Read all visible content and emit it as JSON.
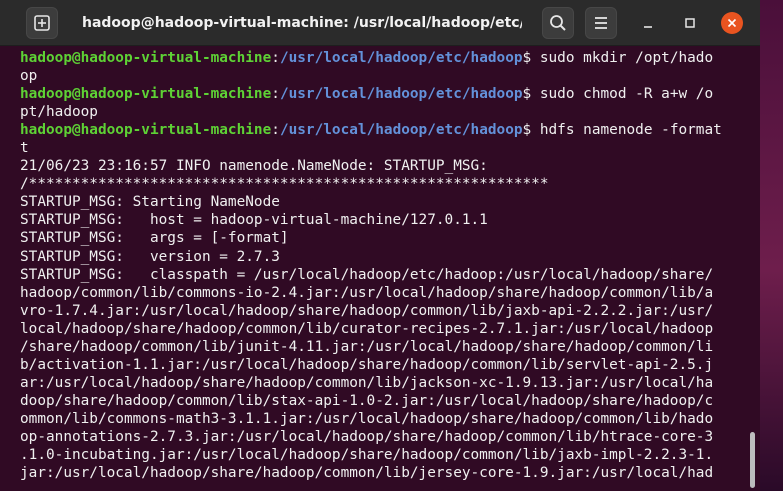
{
  "window": {
    "title": "hadoop@hadoop-virtual-machine: /usr/local/hadoop/etc/ha...",
    "icons": {
      "new_tab": "new-tab-icon",
      "search": "search-icon",
      "menu": "hamburger-menu-icon",
      "minimize": "minimize-icon",
      "maximize": "maximize-icon",
      "close": "close-icon"
    },
    "colors": {
      "terminal_bg": "#300a24",
      "prompt_user": "#5ed235",
      "prompt_path": "#6391d9",
      "text": "#f0f0f0",
      "close_button": "#e95420"
    }
  },
  "terminal": {
    "lines": [
      {
        "user": "hadoop@hadoop-virtual-machine",
        "sep": ":",
        "path": "/usr/local/hadoop/etc/hadoop",
        "text": "$ sudo mkdir /opt/hado"
      },
      {
        "text": "op"
      },
      {
        "user": "hadoop@hadoop-virtual-machine",
        "sep": ":",
        "path": "/usr/local/hadoop/etc/hadoop",
        "text": "$ sudo chmod -R a+w /o"
      },
      {
        "text": "pt/hadoop"
      },
      {
        "user": "hadoop@hadoop-virtual-machine",
        "sep": ":",
        "path": "/usr/local/hadoop/etc/hadoop",
        "text": "$ hdfs namenode -format"
      },
      {
        "text": "t"
      },
      {
        "text": "21/06/23 23:16:57 INFO namenode.NameNode: STARTUP_MSG:"
      },
      {
        "text": "/************************************************************"
      },
      {
        "text": "STARTUP_MSG: Starting NameNode"
      },
      {
        "text": "STARTUP_MSG:   host = hadoop-virtual-machine/127.0.1.1"
      },
      {
        "text": "STARTUP_MSG:   args = [-format]"
      },
      {
        "text": "STARTUP_MSG:   version = 2.7.3"
      },
      {
        "text": "STARTUP_MSG:   classpath = /usr/local/hadoop/etc/hadoop:/usr/local/hadoop/share/"
      },
      {
        "text": "hadoop/common/lib/commons-io-2.4.jar:/usr/local/hadoop/share/hadoop/common/lib/a"
      },
      {
        "text": "vro-1.7.4.jar:/usr/local/hadoop/share/hadoop/common/lib/jaxb-api-2.2.2.jar:/usr/"
      },
      {
        "text": "local/hadoop/share/hadoop/common/lib/curator-recipes-2.7.1.jar:/usr/local/hadoop"
      },
      {
        "text": "/share/hadoop/common/lib/junit-4.11.jar:/usr/local/hadoop/share/hadoop/common/li"
      },
      {
        "text": "b/activation-1.1.jar:/usr/local/hadoop/share/hadoop/common/lib/servlet-api-2.5.j"
      },
      {
        "text": "ar:/usr/local/hadoop/share/hadoop/common/lib/jackson-xc-1.9.13.jar:/usr/local/ha"
      },
      {
        "text": "doop/share/hadoop/common/lib/stax-api-1.0-2.jar:/usr/local/hadoop/share/hadoop/c"
      },
      {
        "text": "ommon/lib/commons-math3-3.1.1.jar:/usr/local/hadoop/share/hadoop/common/lib/hado"
      },
      {
        "text": "op-annotations-2.7.3.jar:/usr/local/hadoop/share/hadoop/common/lib/htrace-core-3"
      },
      {
        "text": ".1.0-incubating.jar:/usr/local/hadoop/share/hadoop/common/lib/jaxb-impl-2.2.3-1."
      },
      {
        "text": "jar:/usr/local/hadoop/share/hadoop/common/lib/jersey-core-1.9.jar:/usr/local/had"
      }
    ]
  }
}
